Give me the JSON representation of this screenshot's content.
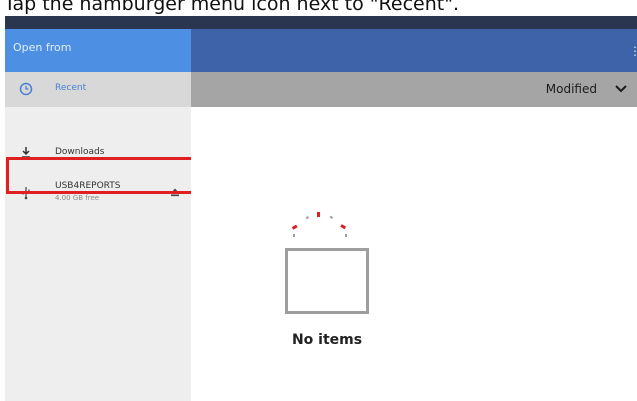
{
  "caption": "Tap the hamburger menu icon next to \"Recent\".",
  "drawer": {
    "title": "Open from",
    "items": [
      {
        "label": "Recent",
        "icon": "clock-icon"
      },
      {
        "label": "Downloads",
        "icon": "download-icon"
      },
      {
        "label": "USB4REPORTS",
        "sublabel": "4.00 GB free",
        "icon": "usb-icon",
        "action_icon": "eject-icon"
      }
    ]
  },
  "toolbar": {
    "sort_label": "Modified",
    "sort_icon": "chevron-down-icon",
    "menu_icon": "overflow-menu-icon"
  },
  "empty_state": {
    "message": "No items",
    "icon": "empty-folder-icon"
  },
  "colors": {
    "drawer_header": "#4d8fe3",
    "app_bar": "#3f63a8",
    "sort_bar": "#a5a5a5",
    "drawer_bg": "#eeeeee",
    "recent_highlight": "#d8d8d8",
    "annotation_red": "#e02020"
  }
}
